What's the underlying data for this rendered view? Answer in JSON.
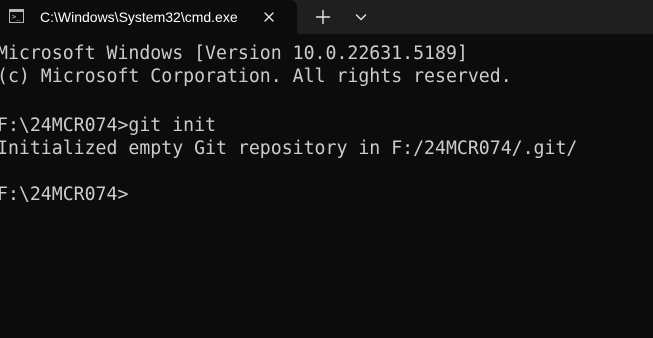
{
  "window": {
    "tab": {
      "title": "C:\\Windows\\System32\\cmd.exe",
      "icon": "command-prompt-icon",
      "icon_glyph": ">_"
    },
    "controls": {
      "close_icon": "close-icon",
      "new_tab_icon": "plus-icon",
      "dropdown_icon": "chevron-down-icon"
    }
  },
  "terminal": {
    "lines": [
      "Microsoft Windows [Version 10.0.22631.5189]",
      "(c) Microsoft Corporation. All rights reserved.",
      "",
      "F:\\24MCR074>git init",
      "Initialized empty Git repository in F:/24MCR074/.git/",
      "",
      "F:\\24MCR074>"
    ]
  },
  "colors": {
    "background": "#0c0c0c",
    "tabbar": "#1f1f1f",
    "text": "#cccccc"
  }
}
